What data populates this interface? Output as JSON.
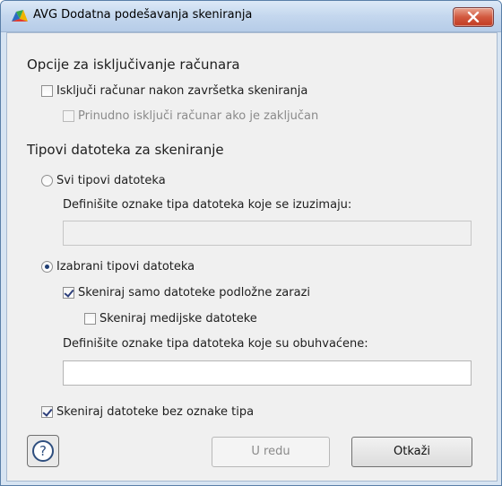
{
  "window": {
    "title": "AVG Dodatna podešavanja skeniranja"
  },
  "shutdown_section": {
    "title": "Opcije za isključivanje računara",
    "shutdown_after_scan": {
      "label": "Isključi računar nakon završetka skeniranja",
      "checked": false
    },
    "force_shutdown_locked": {
      "label": "Prinudno isključi računar ako je zaključan",
      "checked": false,
      "disabled": true
    }
  },
  "filetypes_section": {
    "title": "Tipovi datoteka za skeniranje",
    "all_types": {
      "label": "Svi tipovi datoteka",
      "selected": false,
      "exclusions_label": "Definišite oznake tipa datoteka koje se izuzimaju:",
      "exclusions_value": ""
    },
    "selected_types": {
      "label": "Izabrani tipovi datoteka",
      "selected": true,
      "only_infectable": {
        "label": "Skeniraj samo datoteke podložne zarazi",
        "checked": true
      },
      "media_files": {
        "label": "Skeniraj medijske datoteke",
        "checked": false
      },
      "inclusions_label": "Definišite oznake tipa datoteka koje su obuhvaćene:",
      "inclusions_value": ""
    },
    "no_extension": {
      "label": "Skeniraj datoteke bez oznake tipa",
      "checked": true
    }
  },
  "buttons": {
    "help": "?",
    "ok": "U redu",
    "cancel": "Otkaži"
  },
  "colors": {
    "titlebar": "#c4d7ee",
    "close_button": "#d2593f",
    "client_bg": "#f0f0f0"
  }
}
